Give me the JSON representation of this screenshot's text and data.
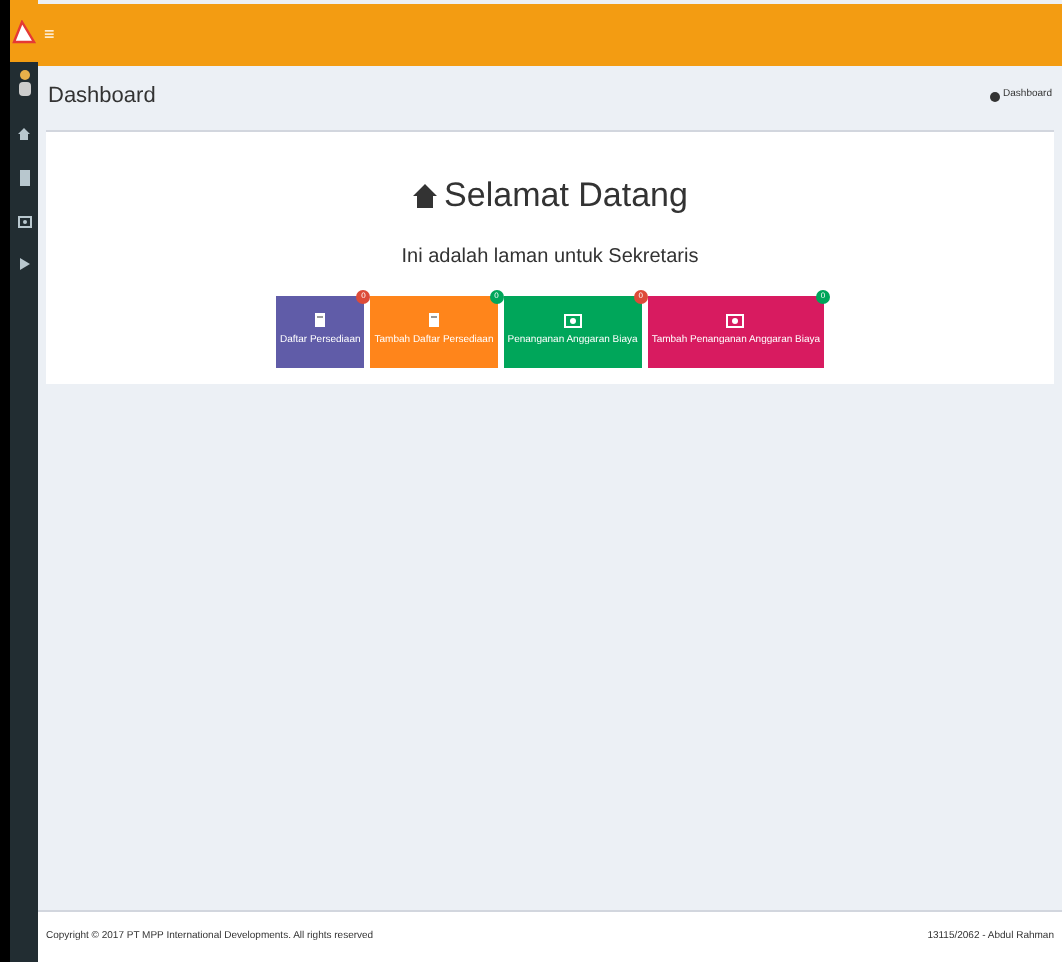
{
  "header": {
    "menu_icon": "≡"
  },
  "page": {
    "title": "Dashboard",
    "breadcrumb": "Dashboard"
  },
  "welcome": {
    "title": "Selamat Datang",
    "subtitle": "Ini adalah laman untuk Sekretaris"
  },
  "tiles": [
    {
      "label": "Daftar Persediaan",
      "badge": {
        "text": "0",
        "color": "#dd4b39"
      },
      "color": "#605ca8",
      "kind": "book"
    },
    {
      "label": "Tambah Daftar Persediaan",
      "badge": {
        "text": "0",
        "color": "#00a65a"
      },
      "color": "#ff851b",
      "kind": "book"
    },
    {
      "label": "Penanganan Anggaran Biaya",
      "badge": {
        "text": "0",
        "color": "#dd4b39"
      },
      "color": "#00a65a",
      "kind": "money"
    },
    {
      "label": "Tambah Penanganan Anggaran Biaya",
      "badge": {
        "text": "0",
        "color": "#00a65a"
      },
      "color": "#d81b60",
      "kind": "money"
    }
  ],
  "footer": {
    "copyright": "Copyright © 2017 PT MPP International Developments. All rights reserved",
    "user": "13115/2062 - Abdul Rahman"
  }
}
